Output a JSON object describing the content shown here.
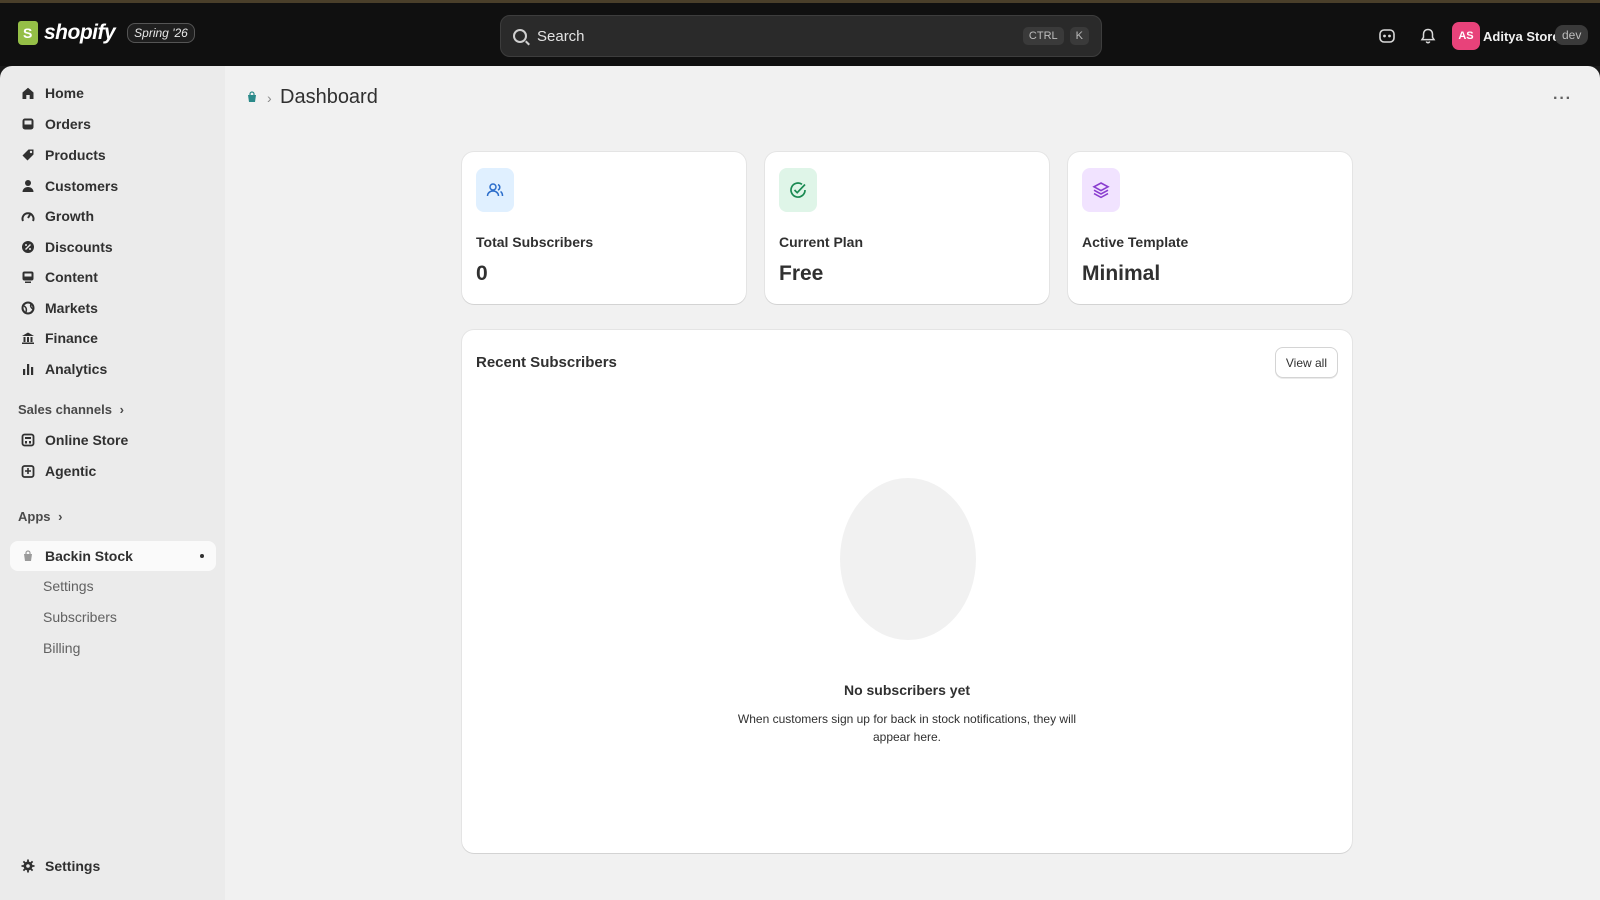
{
  "topbar": {
    "brand": "shopify",
    "edition": "Spring '26",
    "search_placeholder": "Search",
    "shortcut_ctrl": "CTRL",
    "shortcut_key": "K",
    "avatar_initials": "AS",
    "store_name": "Aditya Store",
    "env_badge": "dev"
  },
  "sidebar": {
    "items": [
      {
        "label": "Home",
        "icon": "home-icon"
      },
      {
        "label": "Orders",
        "icon": "inbox-icon"
      },
      {
        "label": "Products",
        "icon": "tag-icon"
      },
      {
        "label": "Customers",
        "icon": "person-icon"
      },
      {
        "label": "Growth",
        "icon": "growth-icon"
      },
      {
        "label": "Discounts",
        "icon": "discount-icon"
      },
      {
        "label": "Content",
        "icon": "content-icon"
      },
      {
        "label": "Markets",
        "icon": "globe-icon"
      },
      {
        "label": "Finance",
        "icon": "bank-icon"
      },
      {
        "label": "Analytics",
        "icon": "bar-chart-icon"
      }
    ],
    "sales_channels_label": "Sales channels",
    "channels": [
      {
        "label": "Online Store",
        "icon": "store-icon"
      },
      {
        "label": "Agentic",
        "icon": "agent-icon"
      }
    ],
    "apps_label": "Apps",
    "app": {
      "label": "Backin Stock",
      "icon": "app-icon"
    },
    "app_subitems": [
      "Settings",
      "Subscribers",
      "Billing"
    ],
    "settings_label": "Settings"
  },
  "header": {
    "title": "Dashboard",
    "more_label": "···"
  },
  "stats": [
    {
      "label": "Total Subscribers",
      "value": "0",
      "icon": "users-icon",
      "icon_bg": "#e0f0ff",
      "icon_color": "#2c6ecb"
    },
    {
      "label": "Current Plan",
      "value": "Free",
      "icon": "check-circle-icon",
      "icon_bg": "#dff5e8",
      "icon_color": "#1a8a52"
    },
    {
      "label": "Active Template",
      "value": "Minimal",
      "icon": "layers-icon",
      "icon_bg": "#f1e3ff",
      "icon_color": "#8a3ecf"
    }
  ],
  "recent": {
    "title": "Recent Subscribers",
    "view_all": "View all",
    "empty_title": "No subscribers yet",
    "empty_text": "When customers sign up for back in stock notifications, they will appear here."
  }
}
